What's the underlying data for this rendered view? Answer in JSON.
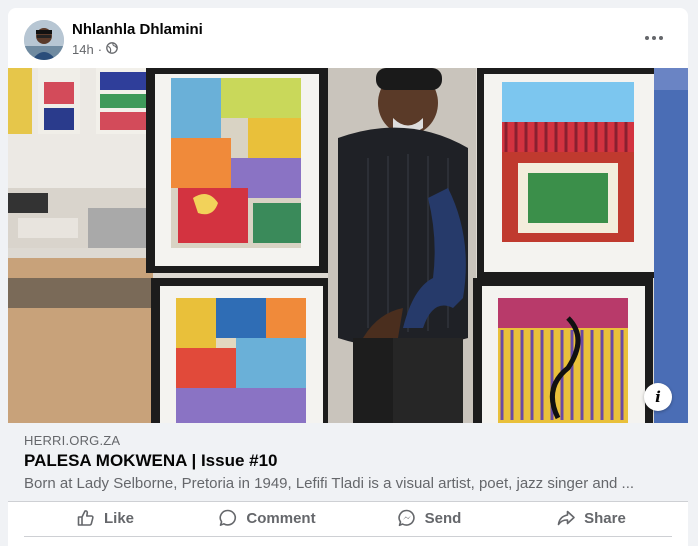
{
  "post": {
    "author": "Nhlanhla Dhlamini",
    "time": "14h",
    "privacy_separator": "·"
  },
  "link": {
    "domain": "HERRI.ORG.ZA",
    "title": "PALESA MOKWENA | Issue #10",
    "description": "Born at Lady Selborne, Pretoria in 1949, Lefifi Tladi is a visual artist, poet, jazz singer and ..."
  },
  "actions": {
    "like": "Like",
    "comment": "Comment",
    "send": "Send",
    "share": "Share"
  },
  "info_glyph": "i",
  "colors": {
    "card_bg": "#ffffff",
    "page_bg": "#f0f2f5",
    "secondary_text": "#65676b",
    "primary_text": "#050505"
  },
  "icons": [
    "globe-icon",
    "more-icon",
    "info-icon",
    "like-icon",
    "comment-icon",
    "send-icon",
    "share-icon"
  ]
}
